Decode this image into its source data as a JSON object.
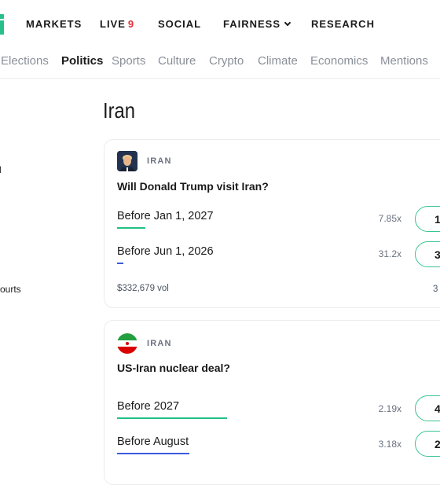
{
  "nav": {
    "items": [
      {
        "label": "MARKETS"
      },
      {
        "label": "LIVE",
        "badge": "9"
      },
      {
        "label": "SOCIAL"
      },
      {
        "label": "FAIRNESS"
      },
      {
        "label": "RESEARCH"
      }
    ]
  },
  "categories": [
    {
      "label": "Elections"
    },
    {
      "label": "Politics"
    },
    {
      "label": "Sports"
    },
    {
      "label": "Culture"
    },
    {
      "label": "Crypto"
    },
    {
      "label": "Climate"
    },
    {
      "label": "Economics"
    },
    {
      "label": "Mentions"
    }
  ],
  "sidebar": {
    "fragments": [
      "l",
      "ourts"
    ]
  },
  "page": {
    "title": "Iran"
  },
  "cards": [
    {
      "tag": "IRAN",
      "question": "Will Donald Trump visit Iran?",
      "options": [
        {
          "label": "Before Jan 1, 2027",
          "multiplier": "7.85x",
          "price": "1",
          "bar_color": "#22c184",
          "bar_fraction": 0.13
        },
        {
          "label": "Before Jun 1, 2026",
          "multiplier": "31.2x",
          "price": "3",
          "bar_color": "#3b5bdb",
          "bar_fraction": 0.03
        }
      ],
      "volume": "$332,679 vol",
      "volume_right": "3"
    },
    {
      "tag": "IRAN",
      "question": "US-Iran nuclear deal?",
      "options": [
        {
          "label": "Before 2027",
          "multiplier": "2.19x",
          "price": "4",
          "bar_color": "#22c184",
          "bar_fraction": 0.5
        },
        {
          "label": "Before August",
          "multiplier": "3.18x",
          "price": "2",
          "bar_color": "#3b5bdb",
          "bar_fraction": 0.33
        }
      ]
    }
  ]
}
